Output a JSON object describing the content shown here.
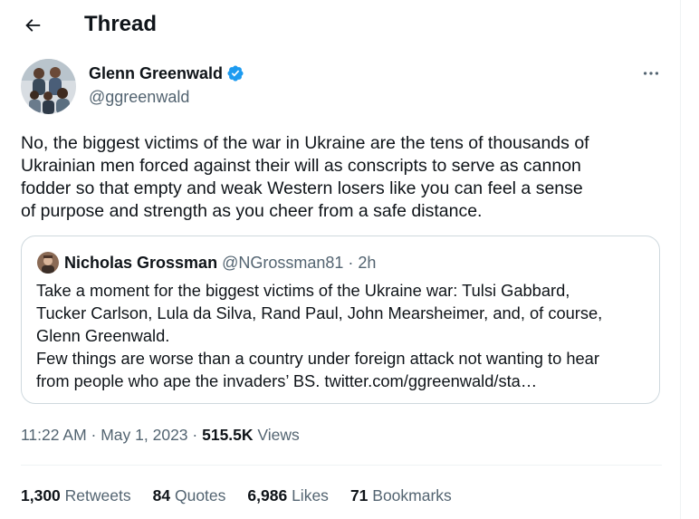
{
  "header": {
    "title": "Thread"
  },
  "tweet": {
    "author_name": "Glenn Greenwald",
    "author_handle": "@ggreenwald",
    "text": "No, the biggest victims of the war in Ukraine are the tens of thousands of\nUkrainian men forced against their will as conscripts to serve as cannon\nfodder so that empty and weak Western losers like you can feel a sense\nof purpose and strength as you cheer from a safe distance."
  },
  "quote": {
    "author_name": "Nicholas Grossman",
    "author_handle": "@NGrossman81",
    "separator": "·",
    "time": "2h",
    "text": "Take a moment for the biggest victims of the Ukraine war: Tulsi Gabbard,\nTucker Carlson, Lula da Silva, Rand Paul, John Mearsheimer, and, of course,\nGlenn Greenwald.\nFew things are worse than a country under foreign attack not wanting to hear\nfrom people who ape the invaders’ BS. twitter.com/ggreenwald/sta…"
  },
  "meta": {
    "time": "11:22 AM",
    "separator": "·",
    "date": "May 1, 2023",
    "views_count": "515.5K",
    "views_label": "Views"
  },
  "stats": {
    "retweets_count": "1,300",
    "retweets_label": "Retweets",
    "quotes_count": "84",
    "quotes_label": "Quotes",
    "likes_count": "6,986",
    "likes_label": "Likes",
    "bookmarks_count": "71",
    "bookmarks_label": "Bookmarks"
  },
  "icons": {
    "back": "arrow-left-icon",
    "verified": "verified-badge-icon",
    "more": "more-horizontal-icon"
  },
  "colors": {
    "text": "#0f1419",
    "muted": "#536471",
    "verified": "#1d9bf0",
    "border": "#cfd9de"
  }
}
